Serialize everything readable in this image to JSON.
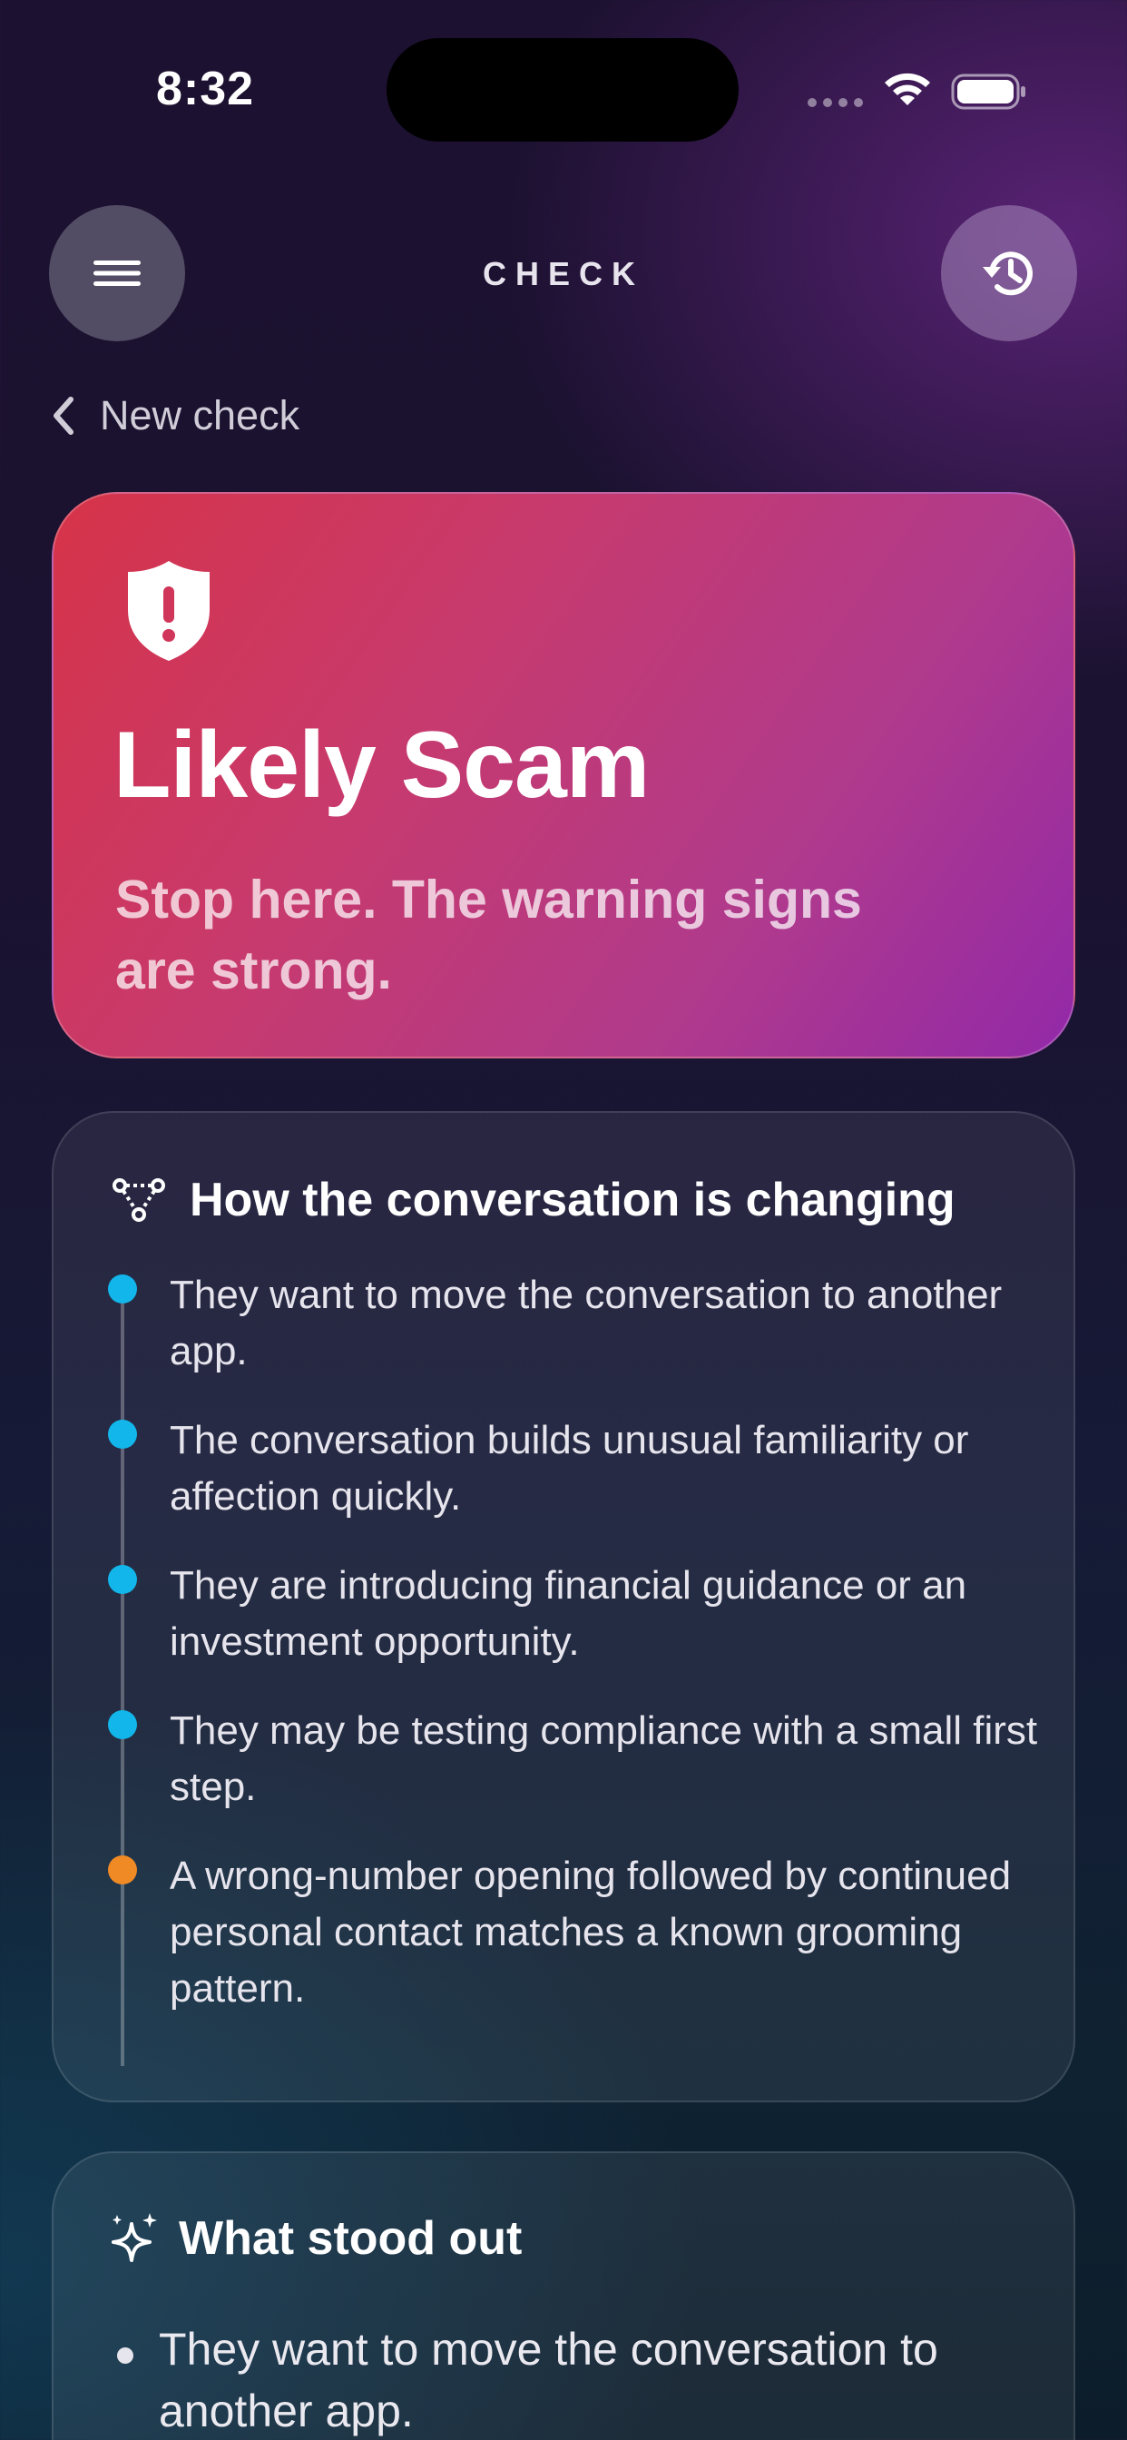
{
  "status_bar": {
    "time": "8:32"
  },
  "header": {
    "title": "CHECK"
  },
  "back": {
    "label": "New check"
  },
  "verdict": {
    "title": "Likely Scam",
    "subtitle": "Stop here. The warning signs are strong.",
    "gradient": [
      "#d63348",
      "#9229a8"
    ]
  },
  "trajectory": {
    "title": "How the conversation is changing",
    "items": [
      {
        "text": "They want to move the conversation to another app.",
        "dot_color": "#12b6ea"
      },
      {
        "text": "The conversation builds unusual familiarity or affection quickly.",
        "dot_color": "#12b6ea"
      },
      {
        "text": "They are introducing financial guidance or an investment opportunity.",
        "dot_color": "#12b6ea"
      },
      {
        "text": "They may be testing compliance with a small first step.",
        "dot_color": "#12b6ea"
      },
      {
        "text": "A wrong-number opening followed by continued personal contact matches a known grooming pattern.",
        "dot_color": "#f08a24"
      }
    ]
  },
  "standout": {
    "title": "What stood out",
    "items": [
      {
        "text": "They want to move the conversation to another app."
      }
    ]
  }
}
